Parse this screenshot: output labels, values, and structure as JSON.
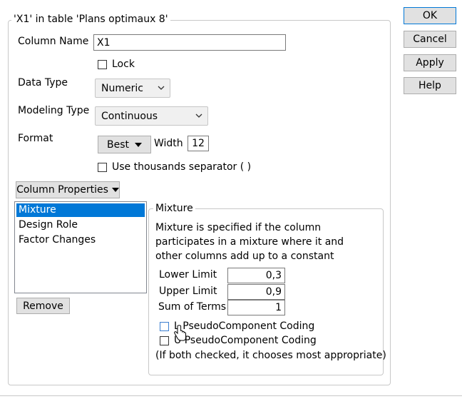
{
  "dialog_buttons": {
    "ok": "OK",
    "cancel": "Cancel",
    "apply": "Apply",
    "help": "Help"
  },
  "column_group": {
    "title": "'X1' in table 'Plans optimaux 8'"
  },
  "column_name": {
    "label": "Column Name",
    "value": "X1"
  },
  "lock": {
    "label": "Lock",
    "checked": false
  },
  "data_type": {
    "label": "Data Type",
    "selected": "Numeric"
  },
  "modeling_type": {
    "label": "Modeling Type",
    "selected": "Continuous"
  },
  "format": {
    "label": "Format",
    "selected": "Best",
    "width_label": "Width",
    "width_value": "12"
  },
  "thousands": {
    "label": "Use thousands separator ( )",
    "checked": false
  },
  "column_properties": {
    "button_label": "Column Properties",
    "items": [
      {
        "label": "Mixture",
        "selected": true
      },
      {
        "label": "Design Role",
        "selected": false
      },
      {
        "label": "Factor Changes",
        "selected": false
      }
    ],
    "remove_label": "Remove"
  },
  "mixture": {
    "title": "Mixture",
    "description_lines": [
      "Mixture is specified if the column",
      "participates in a mixture where it and",
      "other columns add up to a constant"
    ],
    "lower_limit": {
      "label": "Lower Limit",
      "value": "0,3"
    },
    "upper_limit": {
      "label": "Upper Limit",
      "value": "0,9"
    },
    "sum_of_terms": {
      "label": "Sum of Terms",
      "value": "1"
    },
    "l_pseudo": {
      "label": "L PseudoComponent Coding",
      "checked": false
    },
    "u_pseudo": {
      "label": "U PseudoComponent Coding",
      "checked": false
    },
    "note": "(If both checked, it chooses most appropriate)"
  },
  "colors": {
    "selection": "#0078d7",
    "focus_checkbox": "#3c7fd0"
  }
}
